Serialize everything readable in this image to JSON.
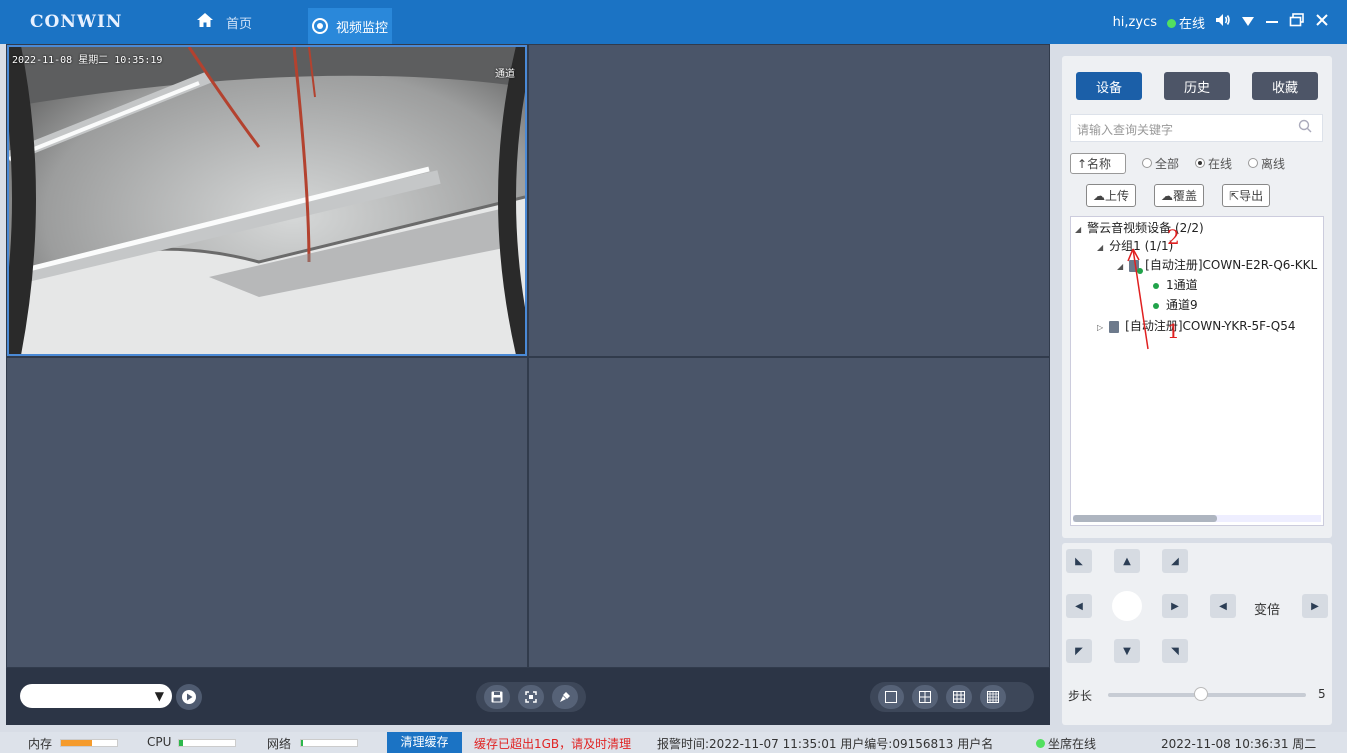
{
  "titlebar": {
    "logo": "CONWIN",
    "home_label": "首页",
    "active_tab_label": "视频监控",
    "greeting": "hi,zycs",
    "status": "在线",
    "bg_color": "#1b73c4"
  },
  "video": {
    "osd_datetime": "2022-11-08 星期二 10:35:19",
    "osd_channel": "通道"
  },
  "panel": {
    "tabs": [
      {
        "label": "设备",
        "active": true
      },
      {
        "label": "历史",
        "active": false
      },
      {
        "label": "收藏",
        "active": false
      }
    ],
    "search_placeholder": "请输入查询关键字",
    "sort_label": "↑名称",
    "filters": [
      {
        "label": "全部",
        "selected": false
      },
      {
        "label": "在线",
        "selected": true
      },
      {
        "label": "离线",
        "selected": false
      }
    ],
    "actions": [
      "上传",
      "覆盖",
      "导出"
    ],
    "tree": {
      "root": "警云音视频设备 (2/2)",
      "group": "分组1 (1/1)",
      "device1": "[自动注册]COWN-E2R-Q6-KKL",
      "channel1": "1通道",
      "channel2": "通道9",
      "device2": "[自动注册]COWN-YKR-5F-Q54"
    },
    "annotations": [
      "2",
      "1"
    ]
  },
  "ptz": {
    "zoom_label": "变倍",
    "step_label": "步长",
    "step_value": "5",
    "step_level": 0.45
  },
  "statusbar": {
    "memory_label": "内存",
    "memory_level": 0.55,
    "cpu_label": "CPU",
    "cpu_level": 0.08,
    "network_label": "网络",
    "network_level": 0.04,
    "clear_cache_label": "清理缓存",
    "cache_warning": "缓存已超出1GB，请及时清理",
    "alarm_info": "报警时间:2022-11-07 11:35:01  用户编号:09156813  用户名",
    "seat_status": "坐席在线",
    "datetime": "2022-11-08 10:36:31 周二"
  }
}
